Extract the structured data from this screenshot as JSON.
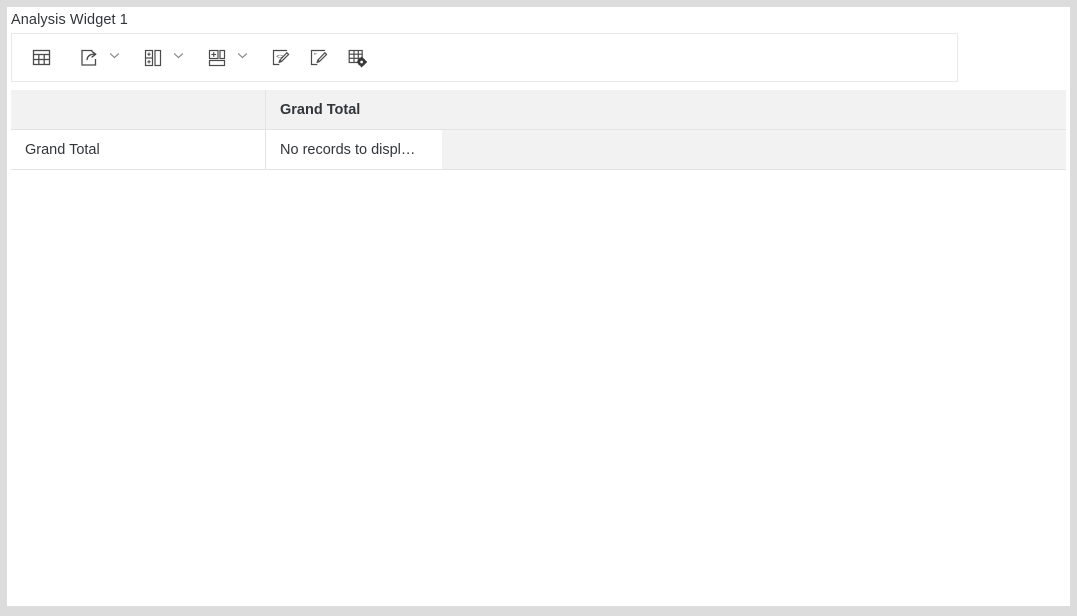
{
  "widget": {
    "title": "Analysis Widget 1"
  },
  "toolbar": {
    "buttons": [
      {
        "name": "table-view-button",
        "icon": "table-icon",
        "label": "Table View"
      },
      {
        "name": "export-button",
        "icon": "export-icon",
        "label": "Export"
      },
      {
        "name": "export-menu-caret",
        "icon": "chevron-down-icon",
        "label": "Export options"
      },
      {
        "name": "insert-column-button",
        "icon": "insert-column-icon",
        "label": "Insert Column"
      },
      {
        "name": "insert-column-caret",
        "icon": "chevron-down-icon",
        "label": "Insert column options"
      },
      {
        "name": "insert-row-button",
        "icon": "insert-row-icon",
        "label": "Insert Row"
      },
      {
        "name": "insert-row-caret",
        "icon": "chevron-down-icon",
        "label": "Insert row options"
      },
      {
        "name": "edit-formula-button",
        "icon": "page-code-edit-icon",
        "label": "Edit Formula"
      },
      {
        "name": "edit-comment-button",
        "icon": "page-text-edit-icon",
        "label": "Edit Comment"
      },
      {
        "name": "table-settings-button",
        "icon": "table-gear-icon",
        "label": "Table Settings"
      }
    ]
  },
  "table": {
    "header": {
      "dimension": "",
      "measure": "Grand Total"
    },
    "rows": [
      {
        "dimension": "Grand Total",
        "value": "No records to displ…"
      }
    ]
  },
  "colors": {
    "page_background": "#ffffff",
    "outer_background": "#dcdcdc",
    "header_fill": "#f2f2f2",
    "cell_fill": "#ffffff",
    "border": "#e3e3e3",
    "text": "#32363a",
    "icon": "#4b4b4b"
  }
}
